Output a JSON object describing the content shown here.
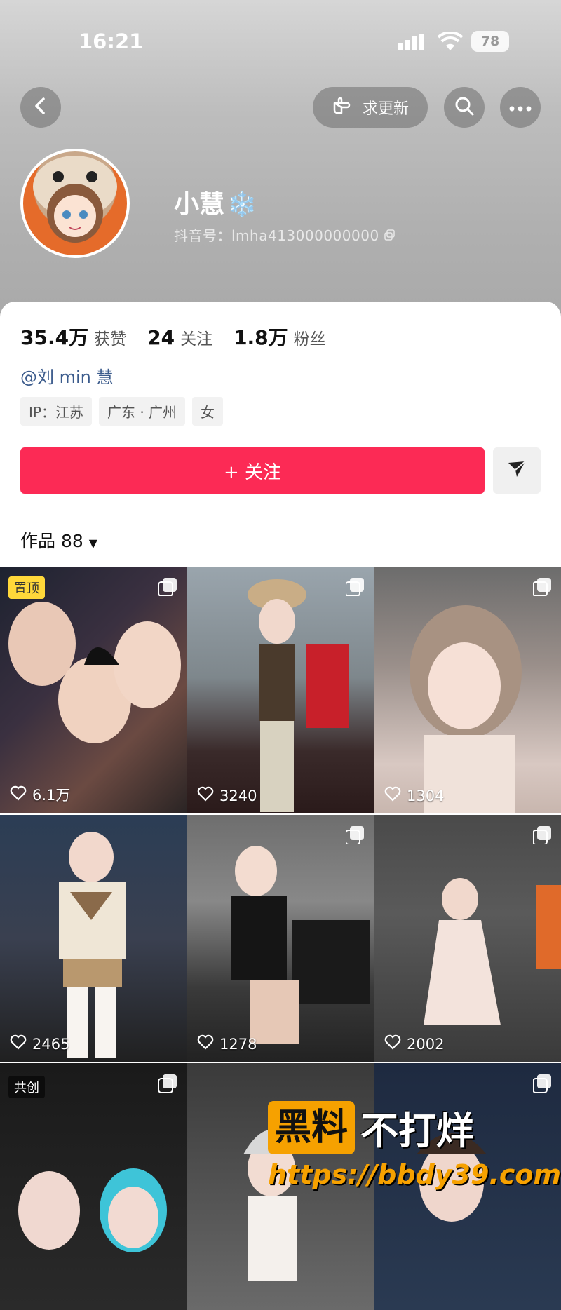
{
  "status_bar": {
    "time": "16:21",
    "battery": "78"
  },
  "header": {
    "request_update_label": "求更新",
    "nickname": "小慧",
    "nickname_emoji": "❄️",
    "douyin_id": "抖音号：lmha413000000000"
  },
  "profile": {
    "stats": [
      {
        "value": "35.4万",
        "label": "获赞"
      },
      {
        "value": "24",
        "label": "关注"
      },
      {
        "value": "1.8万",
        "label": "粉丝"
      }
    ],
    "mention": "@刘 min 慧",
    "tags": [
      "IP：江苏",
      "广东 · 广州",
      "女"
    ],
    "follow_label": "+ 关注",
    "works_label": "作品 88"
  },
  "posts": [
    {
      "likes": "6.1万",
      "badge": "置顶"
    },
    {
      "likes": "3240"
    },
    {
      "likes": "1304"
    },
    {
      "likes": "2465"
    },
    {
      "likes": "1278"
    },
    {
      "likes": "2002"
    },
    {
      "likes": "",
      "badge": "共创"
    },
    {
      "likes": ""
    },
    {
      "likes": ""
    }
  ],
  "watermark": {
    "box": "黑料",
    "text": "不打烊",
    "url": "https://bbdy39.com"
  },
  "colors": {
    "follow": "#fc2a55",
    "pin_badge": "#ffd83a",
    "watermark": "#f6a100"
  },
  "icons": [
    "back-icon",
    "pointing-hand-icon",
    "search-icon",
    "more-icon",
    "copy-icon",
    "send-icon",
    "heart-icon",
    "multi-image-icon",
    "signal-icon",
    "wifi-icon"
  ]
}
